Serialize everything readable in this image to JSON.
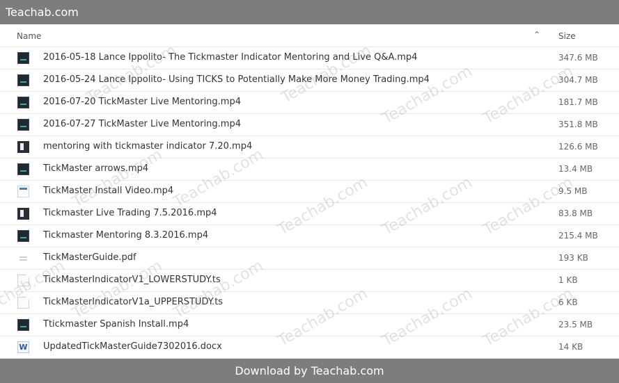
{
  "topbar": {
    "title": "Teachab.com"
  },
  "header": {
    "name_label": "Name",
    "sort_glyph": "⌃",
    "size_label": "Size"
  },
  "files": [
    {
      "name": "2016-05-18 Lance Ippolito- The Tickmaster Indicator Mentoring and Live Q&A.mp4",
      "size": "347.6 MB",
      "icon": "video-thumbnail-icon"
    },
    {
      "name": "2016-05-24 Lance Ippolito- Using TICKS to Potentially Make More Money Trading.mp4",
      "size": "304.7 MB",
      "icon": "video-thumbnail-icon"
    },
    {
      "name": "2016-07-20 TickMaster Live Mentoring.mp4",
      "size": "181.7 MB",
      "icon": "video-thumbnail-icon"
    },
    {
      "name": "2016-07-27 TickMaster Live Mentoring.mp4",
      "size": "351.8 MB",
      "icon": "video-thumbnail-icon"
    },
    {
      "name": "mentoring with tickmaster indicator 7.20.mp4",
      "size": "126.6 MB",
      "icon": "video-thumbnail-icon"
    },
    {
      "name": "TickMaster arrows.mp4",
      "size": "13.4 MB",
      "icon": "video-thumbnail-icon"
    },
    {
      "name": "TickMaster Install Video.mp4",
      "size": "9.5 MB",
      "icon": "video-thumbnail-icon"
    },
    {
      "name": "Tickmaster Live Trading 7.5.2016.mp4",
      "size": "83.8 MB",
      "icon": "video-thumbnail-icon"
    },
    {
      "name": "Tickmaster Mentoring 8.3.2016.mp4",
      "size": "215.4 MB",
      "icon": "video-thumbnail-icon"
    },
    {
      "name": "TickMasterGuide.pdf",
      "size": "193 KB",
      "icon": "pdf-file-icon"
    },
    {
      "name": "TickMasterIndicatorV1_LOWERSTUDY.ts",
      "size": "1 KB",
      "icon": "generic-file-icon"
    },
    {
      "name": "TickMasterIndicatorV1a_UPPERSTUDY.ts",
      "size": "6 KB",
      "icon": "generic-file-icon"
    },
    {
      "name": "Ttickmaster Spanish Install.mp4",
      "size": "23.5 MB",
      "icon": "video-thumbnail-icon"
    },
    {
      "name": "UpdatedTickMasterGuide7302016.docx",
      "size": "14 KB",
      "icon": "word-file-icon"
    }
  ],
  "word_icon_letter": "W",
  "watermark_text": "Teachab.com",
  "footer": {
    "text": "Download by Teachab.com"
  },
  "colors": {
    "bar": "#7d7d7d",
    "row_border": "#e8e8e8",
    "text": "#333333",
    "size_text": "#666666"
  }
}
